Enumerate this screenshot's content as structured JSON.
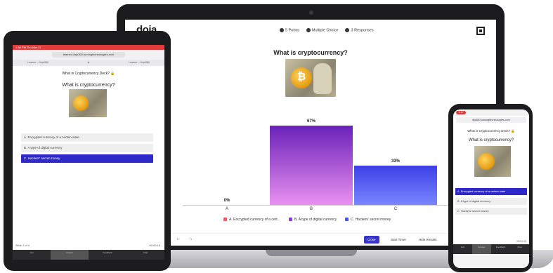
{
  "laptop": {
    "logo": "doja",
    "meta": [
      "5 Points",
      "Multiple Choice",
      "3 Responses"
    ],
    "question": "What is cryptocurrency?",
    "nav": [
      "‹",
      "←",
      "→"
    ],
    "close_label": "Close",
    "tools": [
      "Start Timer",
      "Hide Results"
    ],
    "legend": [
      {
        "key": "A.",
        "text": "Encrypted currency of a cert..."
      },
      {
        "key": "B.",
        "text": "A type of digital currency"
      },
      {
        "key": "C.",
        "text": "Hackers' secret money"
      }
    ]
  },
  "chart_data": {
    "type": "bar",
    "categories": [
      "A",
      "B",
      "C"
    ],
    "values": [
      0,
      67,
      33
    ],
    "value_labels": [
      "0%",
      "67%",
      "33%"
    ],
    "ylim": [
      0,
      100
    ],
    "colors": [
      "#e85a6a",
      "#8e36d8",
      "#4a50ee"
    ],
    "legend_position": "bottom"
  },
  "tablet": {
    "status_time": "1:38 PM  Thu Mar 31",
    "url": "learner-dojo360.turningtechnologies.com",
    "tabs": [
      "Learner – Dojo360",
      "⊕",
      "Learner – Dojo360"
    ],
    "deck_title": "What is Cryptocurrency Deck? 🔒",
    "question": "What is cryptocurrency?",
    "options": [
      {
        "key": "A",
        "text": "Encrypted currency of a certain state",
        "selected": false
      },
      {
        "key": "B",
        "text": "A type of digital currency",
        "selected": false
      },
      {
        "key": "C",
        "text": "Hackers' secret money",
        "selected": true
      }
    ],
    "slide": "Slide 1 of 4",
    "time": "00:00:16",
    "bottom_nav": [
      "Join",
      "Answer",
      "Feedback",
      "Chat"
    ]
  },
  "phone": {
    "status_time": "1:17",
    "url": "djo360.turningtechnologies.com",
    "deck_title": "What is Cryptocurrency Deck? 🔒",
    "question": "What is cryptocurrency?",
    "options": [
      {
        "key": "A",
        "text": "Encrypted currency of a certain state",
        "selected": true
      },
      {
        "key": "B",
        "text": "A type of digital currency",
        "selected": false
      },
      {
        "key": "C",
        "text": "Hackers' secret money",
        "selected": false
      }
    ],
    "time": "00:01:20",
    "bottom_nav": [
      "Join",
      "Answer",
      "Feedback",
      "Chat"
    ]
  }
}
